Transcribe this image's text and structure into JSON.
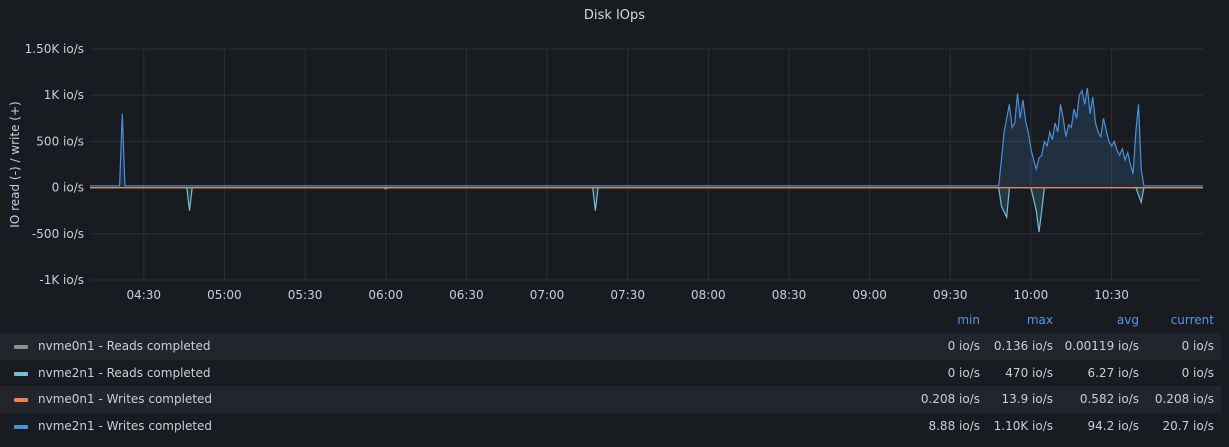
{
  "panel": {
    "title": "Disk IOps"
  },
  "chart_data": {
    "type": "area",
    "title": "Disk IOps",
    "ylabel": "IO read (-) / write (+)",
    "ylim": [
      -1000,
      1500
    ],
    "yticks": [
      1500,
      1000,
      500,
      0,
      -500,
      -1000
    ],
    "ytick_labels": [
      "1.50K io/s",
      "1K io/s",
      "500 io/s",
      "0 io/s",
      "-500 io/s",
      "-1K io/s"
    ],
    "xlim": [
      "04:10",
      "11:04"
    ],
    "xticks": [
      "04:30",
      "05:00",
      "05:30",
      "06:00",
      "06:30",
      "07:00",
      "07:30",
      "08:00",
      "08:30",
      "09:00",
      "09:30",
      "10:00",
      "10:30"
    ],
    "grid": true,
    "legend_placement": "bottom",
    "series": [
      {
        "name": "nvme0n1 - Reads completed",
        "color": "#8e8e8e",
        "points": [
          [
            "04:10",
            0
          ],
          [
            "05:59",
            0
          ],
          [
            "06:00",
            -15
          ],
          [
            "06:01",
            0
          ],
          [
            "11:04",
            0
          ]
        ]
      },
      {
        "name": "nvme2n1 - Reads completed",
        "color": "#73bfd8",
        "points": [
          [
            "04:10",
            0
          ],
          [
            "04:46",
            0
          ],
          [
            "04:47",
            -250
          ],
          [
            "04:48",
            0
          ],
          [
            "07:17",
            0
          ],
          [
            "07:18",
            -250
          ],
          [
            "07:19",
            0
          ],
          [
            "09:48",
            0
          ],
          [
            "09:49",
            -200
          ],
          [
            "09:51",
            -320
          ],
          [
            "09:52",
            0
          ],
          [
            "10:00",
            0
          ],
          [
            "10:02",
            -250
          ],
          [
            "10:03",
            -480
          ],
          [
            "10:04",
            -250
          ],
          [
            "10:05",
            0
          ],
          [
            "10:39",
            0
          ],
          [
            "10:41",
            -160
          ],
          [
            "10:42",
            0
          ],
          [
            "11:04",
            0
          ]
        ]
      },
      {
        "name": "nvme0n1 - Writes completed",
        "color": "#f2824c",
        "points": [
          [
            "04:10",
            0
          ],
          [
            "11:04",
            0
          ]
        ]
      },
      {
        "name": "nvme2n1 - Writes completed",
        "color": "#4a90d9",
        "points": [
          [
            "04:10",
            20
          ],
          [
            "04:21",
            20
          ],
          [
            "04:22",
            800
          ],
          [
            "04:23",
            20
          ],
          [
            "09:48",
            20
          ],
          [
            "09:49",
            300
          ],
          [
            "09:50",
            600
          ],
          [
            "09:51",
            750
          ],
          [
            "09:52",
            900
          ],
          [
            "09:53",
            650
          ],
          [
            "09:54",
            700
          ],
          [
            "09:55",
            1020
          ],
          [
            "09:56",
            750
          ],
          [
            "09:57",
            950
          ],
          [
            "09:58",
            720
          ],
          [
            "09:59",
            600
          ],
          [
            "10:00",
            420
          ],
          [
            "10:01",
            300
          ],
          [
            "10:02",
            200
          ],
          [
            "10:03",
            320
          ],
          [
            "10:04",
            350
          ],
          [
            "10:05",
            500
          ],
          [
            "10:06",
            450
          ],
          [
            "10:07",
            600
          ],
          [
            "10:08",
            520
          ],
          [
            "10:09",
            700
          ],
          [
            "10:10",
            600
          ],
          [
            "10:11",
            900
          ],
          [
            "10:12",
            750
          ],
          [
            "10:13",
            550
          ],
          [
            "10:14",
            680
          ],
          [
            "10:15",
            650
          ],
          [
            "10:16",
            850
          ],
          [
            "10:17",
            750
          ],
          [
            "10:18",
            1000
          ],
          [
            "10:19",
            1050
          ],
          [
            "10:20",
            900
          ],
          [
            "10:21",
            1080
          ],
          [
            "10:22",
            800
          ],
          [
            "10:23",
            980
          ],
          [
            "10:24",
            700
          ],
          [
            "10:25",
            600
          ],
          [
            "10:26",
            550
          ],
          [
            "10:27",
            750
          ],
          [
            "10:28",
            620
          ],
          [
            "10:29",
            500
          ],
          [
            "10:30",
            450
          ],
          [
            "10:31",
            500
          ],
          [
            "10:32",
            400
          ],
          [
            "10:33",
            350
          ],
          [
            "10:34",
            420
          ],
          [
            "10:35",
            300
          ],
          [
            "10:36",
            380
          ],
          [
            "10:37",
            250
          ],
          [
            "10:38",
            150
          ],
          [
            "10:39",
            600
          ],
          [
            "10:40",
            900
          ],
          [
            "10:41",
            200
          ],
          [
            "10:42",
            20
          ],
          [
            "11:04",
            20
          ]
        ]
      }
    ]
  },
  "legend": {
    "headers": {
      "min": "min",
      "max": "max",
      "avg": "avg",
      "current": "current"
    },
    "rows": [
      {
        "name": "nvme0n1 - Reads completed",
        "color": "#8e8e8e",
        "min": "0 io/s",
        "max": "0.136 io/s",
        "avg": "0.00119 io/s",
        "current": "0 io/s"
      },
      {
        "name": "nvme2n1 - Reads completed",
        "color": "#73bfd8",
        "min": "0 io/s",
        "max": "470 io/s",
        "avg": "6.27 io/s",
        "current": "0 io/s"
      },
      {
        "name": "nvme0n1 - Writes completed",
        "color": "#f2824c",
        "min": "0.208 io/s",
        "max": "13.9 io/s",
        "avg": "0.582 io/s",
        "current": "0.208 io/s"
      },
      {
        "name": "nvme2n1 - Writes completed",
        "color": "#4a90d9",
        "min": "8.88 io/s",
        "max": "1.10K io/s",
        "avg": "94.2 io/s",
        "current": "20.7 io/s"
      }
    ]
  }
}
